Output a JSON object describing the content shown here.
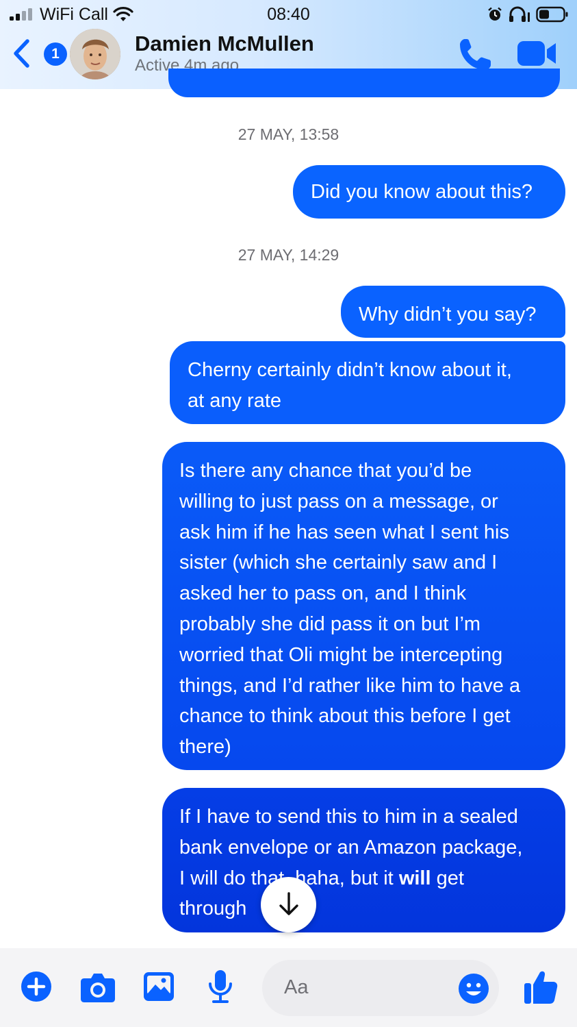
{
  "status_bar": {
    "carrier": "WiFi Call",
    "time": "08:40",
    "signal_bars": 2
  },
  "header": {
    "back_badge": "1",
    "contact_name": "Damien McMullen",
    "contact_status": "Active 4m ago",
    "icons": [
      "chevron-left-icon",
      "phone-icon",
      "video-camera-icon"
    ]
  },
  "messages": [
    {
      "type": "timestamp",
      "text": "27 MAY, 13:58"
    },
    {
      "type": "bubble",
      "lines": [
        "Did you know about this?"
      ]
    },
    {
      "type": "timestamp",
      "text": "27 MAY, 14:29"
    },
    {
      "type": "bubble",
      "lines": [
        "Why didn’t you say?"
      ]
    },
    {
      "type": "bubble",
      "lines": [
        "Cherny certainly didn’t know about it,",
        "at any rate"
      ]
    },
    {
      "type": "bubble",
      "lines": [
        "Is there any chance that you’d be",
        "willing to just pass on a message, or",
        "ask him if he has seen what I sent his",
        "sister (which she certainly saw and I",
        "asked her to pass on, and I think",
        "probably she did pass it on but I’m",
        "worried that Oli might be intercepting",
        "things, and I’d rather like him to have a",
        "chance to think about this before I get",
        "there)"
      ]
    },
    {
      "type": "bubble",
      "line1": "If I have to send this to him in a sealed",
      "line2": "bank envelope or an Amazon package,",
      "line3_before": "I will do that, haha, but it ",
      "line3_bold": "will",
      "line3_after": " get",
      "line4": "through"
    }
  ],
  "composer": {
    "placeholder": "Aa",
    "icons": [
      "plus-icon",
      "camera-icon",
      "image-icon",
      "microphone-icon",
      "smiley-icon",
      "thumbs-up-icon"
    ]
  },
  "colors": {
    "accent": "#0a62ff",
    "bubble_dark": "#0335dc",
    "timestamp": "#6d6d72",
    "header_gradient_end": "#9fd0fb"
  }
}
